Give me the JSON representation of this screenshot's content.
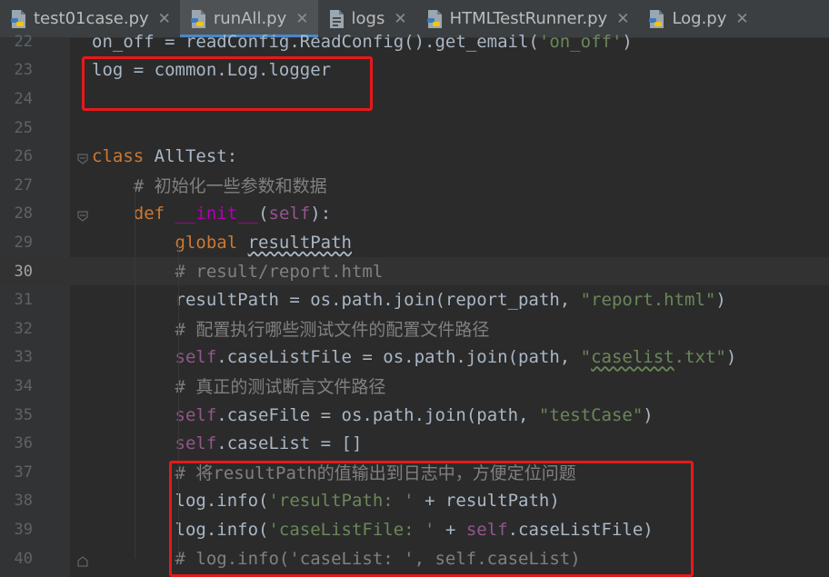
{
  "tabs": [
    {
      "label": "test01case.py",
      "icon": "python-file-icon"
    },
    {
      "label": "runAll.py",
      "icon": "python-file-icon",
      "active": true
    },
    {
      "label": "logs",
      "icon": "text-file-icon"
    },
    {
      "label": "HTMLTestRunner.py",
      "icon": "python-file-icon"
    },
    {
      "label": "Log.py",
      "icon": "python-file-icon"
    }
  ],
  "close_glyph": "✕",
  "current_line": "30",
  "lines": [
    {
      "n": "22",
      "text": "on_off = readConfig.ReadConfig().get_email('on_off')"
    },
    {
      "n": "23",
      "text": "log = common.Log.logger"
    },
    {
      "n": "24",
      "text": ""
    },
    {
      "n": "25",
      "text": ""
    },
    {
      "n": "26",
      "text": "class AllTest:"
    },
    {
      "n": "27",
      "text": "    # 初始化一些参数和数据"
    },
    {
      "n": "28",
      "text": "    def __init__(self):"
    },
    {
      "n": "29",
      "text": "        global resultPath"
    },
    {
      "n": "30",
      "text": "        # result/report.html"
    },
    {
      "n": "31",
      "text": "        resultPath = os.path.join(report_path, \"report.html\")"
    },
    {
      "n": "32",
      "text": "        # 配置执行哪些测试文件的配置文件路径"
    },
    {
      "n": "33",
      "text": "        self.caseListFile = os.path.join(path, \"caselist.txt\")"
    },
    {
      "n": "34",
      "text": "        # 真正的测试断言文件路径"
    },
    {
      "n": "35",
      "text": "        self.caseFile = os.path.join(path, \"testCase\")"
    },
    {
      "n": "36",
      "text": "        self.caseList = []"
    },
    {
      "n": "37",
      "text": "        # 将resultPath的值输出到日志中，方便定位问题"
    },
    {
      "n": "38",
      "text": "        log.info('resultPath: ' + resultPath)"
    },
    {
      "n": "39",
      "text": "        log.info('caseListFile: ' + self.caseListFile)"
    },
    {
      "n": "40",
      "text": "        # log.info('caseList: ', self.caseList)"
    }
  ],
  "colors": {
    "background": "#2b2b2b",
    "keyword": "#cc7832",
    "self": "#94558d",
    "string": "#6a8759",
    "comment": "#808080",
    "magic": "#b200b2",
    "text": "#a9b7c6",
    "highlight_box": "#e8181a"
  }
}
